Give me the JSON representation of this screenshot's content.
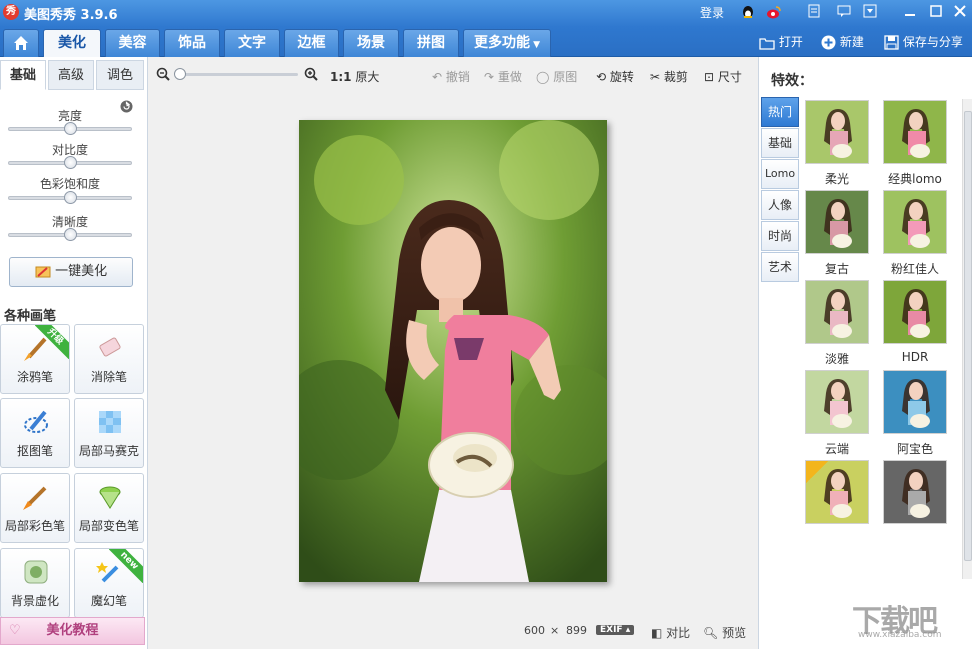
{
  "title": {
    "logo": "秀",
    "app": "美图秀秀 3.9.6",
    "login": "登录"
  },
  "tabs": [
    {
      "label": "美化",
      "active": true
    },
    {
      "label": "美容"
    },
    {
      "label": "饰品"
    },
    {
      "label": "文字"
    },
    {
      "label": "边框"
    },
    {
      "label": "场景"
    },
    {
      "label": "拼图"
    },
    {
      "label": "更多功能"
    }
  ],
  "top_actions": {
    "open": "打开",
    "new": "新建",
    "save": "保存与分享"
  },
  "left": {
    "subtabs": [
      "基础",
      "高级",
      "调色"
    ],
    "sliders": [
      {
        "label": "亮度",
        "value": 0.5
      },
      {
        "label": "对比度",
        "value": 0.5
      },
      {
        "label": "色彩饱和度",
        "value": 0.5
      },
      {
        "label": "清晰度",
        "value": 0.5
      }
    ],
    "one_key": "一键美化",
    "brushes_title": "各种画笔",
    "brushes": [
      {
        "label": "涂鸦笔",
        "badge": "升级"
      },
      {
        "label": "消除笔"
      },
      {
        "label": "抠图笔"
      },
      {
        "label": "局部马赛克"
      },
      {
        "label": "局部彩色笔"
      },
      {
        "label": "局部变色笔"
      },
      {
        "label": "背景虚化"
      },
      {
        "label": "魔幻笔",
        "badge": "new"
      }
    ],
    "tutorial": "美化教程"
  },
  "toolbar": {
    "zoom_ratio": "1:1",
    "original_size": "原大",
    "undo": "撤销",
    "redo": "重做",
    "original": "原图",
    "rotate": "旋转",
    "crop": "裁剪",
    "size": "尺寸"
  },
  "status": {
    "width": "600",
    "times": "×",
    "height": "899",
    "exif": "EXIF",
    "compare": "对比",
    "preview": "预览"
  },
  "effects": {
    "title": "特效：",
    "categories": [
      "热门",
      "基础",
      "Lomo",
      "人像",
      "时尚",
      "艺术"
    ],
    "items": [
      "柔光",
      "经典lomo",
      "复古",
      "粉红佳人",
      "淡雅",
      "HDR",
      "云端",
      "阿宝色",
      "",
      ""
    ]
  },
  "watermark": {
    "text": "下载吧",
    "url": "www.xiazaiba.com"
  }
}
